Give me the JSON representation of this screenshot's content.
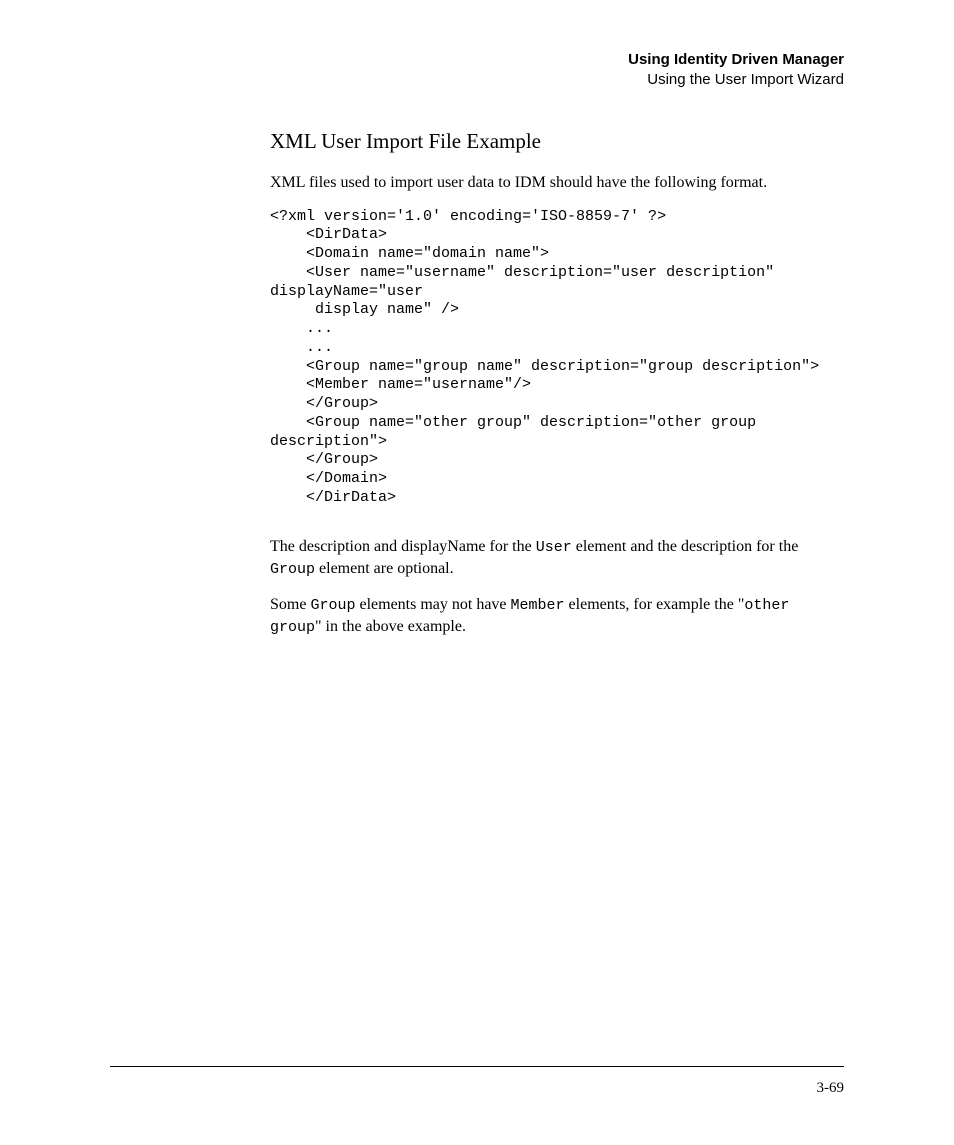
{
  "header": {
    "title_bold": "Using Identity Driven Manager",
    "subtitle": "Using the User Import Wizard"
  },
  "section": {
    "title": "XML User Import File Example",
    "intro": "XML files used to import user data to IDM should have the following format."
  },
  "code": "<?xml version='1.0' encoding='ISO-8859-7' ?>\n    <DirData>\n    <Domain name=\"domain name\">\n    <User name=\"username\" description=\"user description\" \ndisplayName=\"user\n     display name\" />\n    ...\n    ...\n    <Group name=\"group name\" description=\"group description\">\n    <Member name=\"username\"/>\n    </Group>\n    <Group name=\"other group\" description=\"other group \ndescription\">\n    </Group>\n    </Domain>\n    </DirData>",
  "para1": {
    "t1": "The description and displayName for the ",
    "c1": "User",
    "t2": " element and the description for the ",
    "c2": "Group",
    "t3": " element are optional."
  },
  "para2": {
    "t1": "Some ",
    "c1": "Group",
    "t2": " elements may not have ",
    "c2": "Member",
    "t3": " elements, for example the \"",
    "c3": "other group",
    "t4": "\" in the above example."
  },
  "page_number": "3-69"
}
